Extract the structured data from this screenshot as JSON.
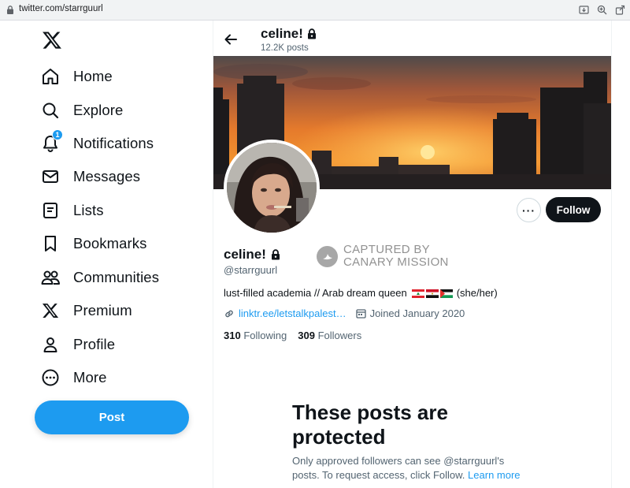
{
  "browser": {
    "url": "twitter.com/starrguurl"
  },
  "nav": {
    "items": [
      {
        "label": "Home",
        "icon": "home-icon"
      },
      {
        "label": "Explore",
        "icon": "search-icon"
      },
      {
        "label": "Notifications",
        "icon": "bell-icon",
        "badge": "1"
      },
      {
        "label": "Messages",
        "icon": "envelope-icon"
      },
      {
        "label": "Lists",
        "icon": "list-icon"
      },
      {
        "label": "Bookmarks",
        "icon": "bookmark-icon"
      },
      {
        "label": "Communities",
        "icon": "people-icon"
      },
      {
        "label": "Premium",
        "icon": "x-logo-icon"
      },
      {
        "label": "Profile",
        "icon": "person-icon"
      },
      {
        "label": "More",
        "icon": "more-circle-icon"
      }
    ],
    "post_label": "Post"
  },
  "header": {
    "name": "celine!",
    "post_count": "12.2K posts"
  },
  "profile": {
    "name": "celine!",
    "handle": "@starrguurl",
    "bio_text": "lust-filled academia // Arab dream queen",
    "bio_suffix": "(she/her)",
    "link": "linktr.ee/letstalkpalest…",
    "joined": "Joined January 2020",
    "following_count": "310",
    "following_label": "Following",
    "followers_count": "309",
    "followers_label": "Followers",
    "follow_label": "Follow",
    "more_label": "···"
  },
  "watermark": {
    "line1": "CAPTURED BY",
    "line2": "CANARY MISSION"
  },
  "protected": {
    "title": "These posts are protected",
    "body": "Only approved followers can see @starrguurl's posts. To request access, click Follow.",
    "learn_more": "Learn more"
  },
  "colors": {
    "accent": "#1d9bf0",
    "text": "#0f1419",
    "muted": "#536471"
  }
}
